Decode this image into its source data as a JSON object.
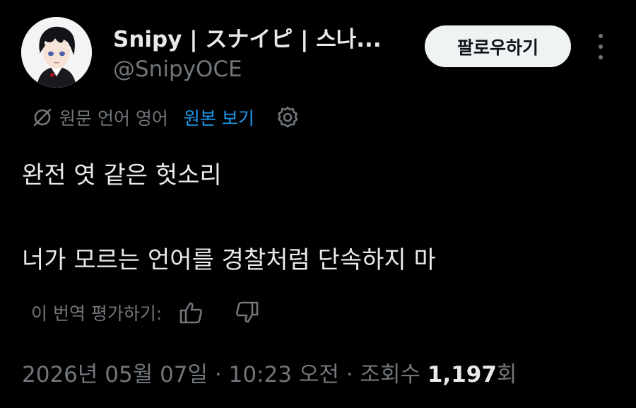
{
  "user": {
    "display_name": "Snipy | スナイピ | 스나...",
    "handle": "@SnipyOCE",
    "follow_label": "팔로우하기"
  },
  "translation": {
    "info": "원문 언어 영어",
    "show_original": "원본 보기"
  },
  "tweet": {
    "line1": "완전 엿 같은 헛소리",
    "line2": "너가 모르는 언어를 경찰처럼 단속하지 마"
  },
  "rate": {
    "label": "이 번역 평가하기:"
  },
  "meta": {
    "date": "2026년 05월 07일",
    "sep1": " · ",
    "time": "10:23 오전",
    "sep2": " · ",
    "views_prefix": "조회수 ",
    "views_count": "1,197",
    "views_suffix": "회"
  },
  "icons": {
    "translate": "translate-icon",
    "settings": "gear-icon",
    "like": "thumbs-up-icon",
    "dislike": "thumbs-down-icon",
    "more": "more-vertical-icon"
  },
  "colors": {
    "background": "#000000",
    "text": "#e7e9ea",
    "muted": "#71767b",
    "link": "#1d9bf0",
    "follow_bg": "#eff3f4"
  }
}
